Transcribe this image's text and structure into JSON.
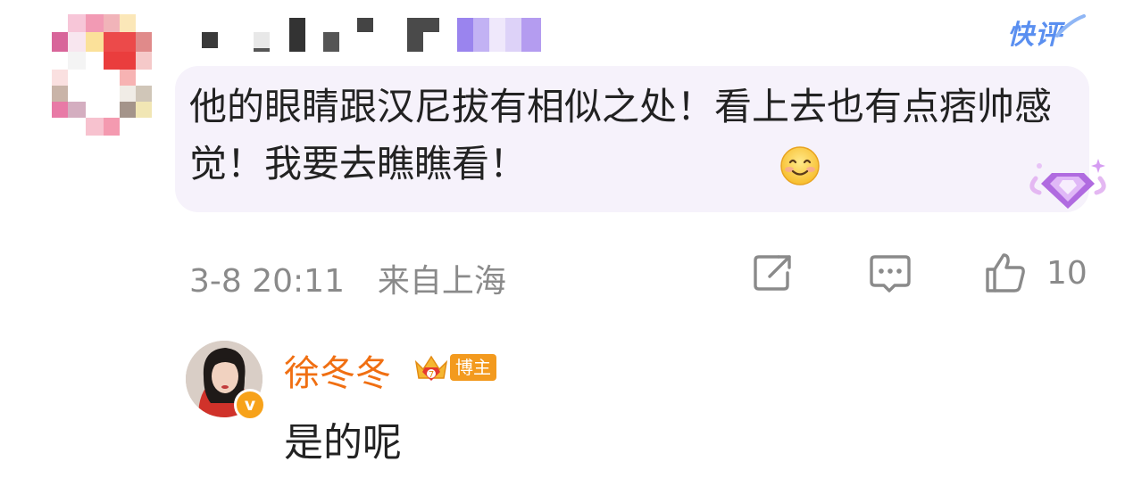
{
  "header": {
    "quick_review_label": "快评"
  },
  "comment": {
    "text": "他的眼睛跟汉尼拔有相似之处！看上去也有点痞帅感觉！我要去瞧瞧看！",
    "emoji": "smile",
    "badge_icon": "gem-badge",
    "timestamp": "3-8 20:11",
    "location": "来自上海",
    "like_count": "10"
  },
  "reply": {
    "author": "徐冬冬",
    "role_badge": "博主",
    "verified_mark": "v",
    "text": "是的呢"
  },
  "colors": {
    "accent_orange": "#f06f12",
    "meta_gray": "#8a8a8a",
    "bubble_bg": "#f6f2fb",
    "quick_review_blue": "#5a8ff0"
  }
}
